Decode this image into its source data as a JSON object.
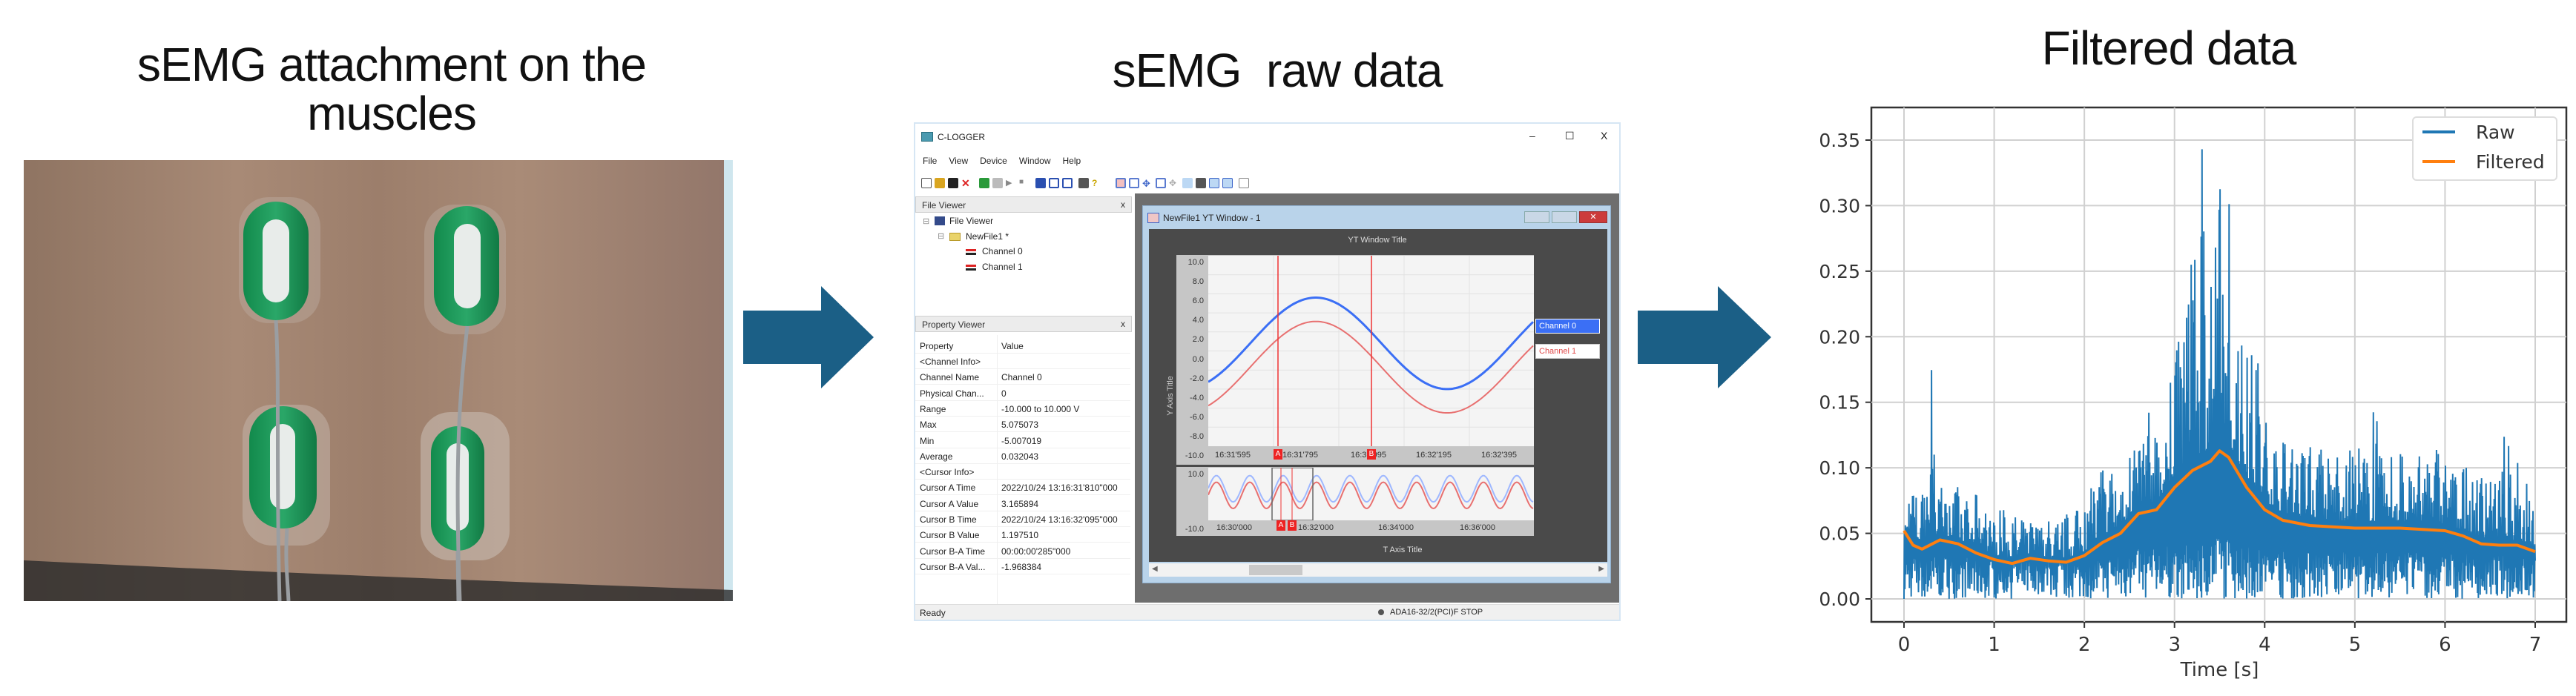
{
  "panels": {
    "left_title_line1": "sEMG attachment on the",
    "left_title_line2": "muscles",
    "middle_title": "sEMG  raw data",
    "right_title": "Filtered data"
  },
  "colors": {
    "arrow": "#1b5f86",
    "sensor": "#1e9a5c",
    "raw": "#1f77b4",
    "filtered": "#ff7f0e",
    "channel0": "#3b6ff5",
    "channel1": "#e14a4a"
  },
  "app": {
    "title": "C-LOGGER",
    "window_controls": [
      "–",
      "☐",
      "X"
    ],
    "menu": [
      "File",
      "View",
      "Device",
      "Window",
      "Help"
    ],
    "file_viewer": {
      "header": "File Viewer",
      "close": "x",
      "tree": {
        "root": "File Viewer",
        "file": "NewFile1 *",
        "channels": [
          "Channel 0",
          "Channel 1"
        ]
      }
    },
    "property_viewer": {
      "header": "Property Viewer",
      "close": "x",
      "columns": [
        "Property",
        "Value"
      ],
      "rows": [
        [
          "<Channel Info>",
          ""
        ],
        [
          "Channel Name",
          "Channel 0"
        ],
        [
          "Physical Chan...",
          "0"
        ],
        [
          "Range",
          "-10.000 to 10.000 V"
        ],
        [
          "Max",
          "5.075073"
        ],
        [
          "Min",
          "-5.007019"
        ],
        [
          "Average",
          "0.032043"
        ],
        [
          "<Cursor Info>",
          ""
        ],
        [
          "Cursor A Time",
          "2022/10/24 13:16:31'810\"000"
        ],
        [
          "Cursor A Value",
          "3.165894"
        ],
        [
          "Cursor B Time",
          "2022/10/24 13:16:32'095\"000"
        ],
        [
          "Cursor B Value",
          "1.197510"
        ],
        [
          "Cursor B-A Time",
          "00:00:00'285\"000"
        ],
        [
          "Cursor B-A Val...",
          "-1.968384"
        ]
      ]
    },
    "yt_window": {
      "title": "NewFile1 YT Window - 1",
      "plot_title": "YT Window Title",
      "y_axis_title": "Y Axis Title",
      "t_axis_title": "T Axis Title",
      "y_ticks": [
        "10.0",
        "8.0",
        "6.0",
        "4.0",
        "2.0",
        "0.0",
        "-2.0",
        "-4.0",
        "-6.0",
        "-8.0",
        "-10.0"
      ],
      "t_ticks": [
        "16:31'595",
        "16:31'795",
        "16:31'995",
        "16:32'195",
        "16:32'395"
      ],
      "overview_y_ticks": [
        "10.0",
        "-10.0"
      ],
      "overview_t_ticks": [
        "16:30'000",
        "16:32'000",
        "16:34'000",
        "16:36'000"
      ],
      "cursor_a": "A",
      "cursor_b": "B",
      "legend": [
        "Channel 0",
        "Channel 1"
      ]
    },
    "status": {
      "left": "Ready",
      "right": "ADA16-32/2(PCI)F STOP"
    }
  },
  "chart_data": {
    "type": "line",
    "title": "Filtered data",
    "xlabel": "Time [s]",
    "ylabel": "",
    "xlim": [
      -0.3,
      7.35
    ],
    "ylim": [
      -0.018,
      0.372
    ],
    "x_ticks": [
      "0",
      "1",
      "2",
      "3",
      "4",
      "5",
      "6",
      "7"
    ],
    "y_ticks": [
      "0.00",
      "0.05",
      "0.10",
      "0.15",
      "0.20",
      "0.25",
      "0.30",
      "0.35"
    ],
    "grid": true,
    "legend": {
      "position": "top-right",
      "entries": [
        "Raw",
        "Filtered"
      ]
    },
    "series": [
      {
        "name": "Raw",
        "note_x_step": 0.1,
        "x_start": 0,
        "envelope_peaks": [
          0.057,
          0.085,
          0.085,
          0.19,
          0.085,
          0.08,
          0.088,
          0.075,
          0.08,
          0.07,
          0.065,
          0.068,
          0.065,
          0.06,
          0.062,
          0.06,
          0.063,
          0.06,
          0.065,
          0.07,
          0.075,
          0.085,
          0.1,
          0.105,
          0.09,
          0.12,
          0.13,
          0.145,
          0.13,
          0.12,
          0.2,
          0.215,
          0.26,
          0.358,
          0.25,
          0.33,
          0.305,
          0.2,
          0.195,
          0.2,
          0.14,
          0.13,
          0.125,
          0.12,
          0.12,
          0.125,
          0.12,
          0.11,
          0.11,
          0.115,
          0.12,
          0.11,
          0.146,
          0.11,
          0.11,
          0.12,
          0.105,
          0.11,
          0.11,
          0.115,
          0.11,
          0.1,
          0.1,
          0.095,
          0.1,
          0.09,
          0.1,
          0.13,
          0.12,
          0.09,
          0.088
        ],
        "min": 0.0
      },
      {
        "name": "Filtered",
        "x": [
          0,
          0.1,
          0.2,
          0.4,
          0.6,
          0.8,
          1.0,
          1.2,
          1.4,
          1.6,
          1.8,
          2.0,
          2.2,
          2.4,
          2.6,
          2.8,
          3.0,
          3.2,
          3.4,
          3.5,
          3.6,
          3.8,
          4.0,
          4.2,
          4.5,
          5.0,
          5.5,
          6.0,
          6.2,
          6.4,
          6.6,
          6.8,
          7.0
        ],
        "y": [
          0.052,
          0.041,
          0.038,
          0.045,
          0.042,
          0.035,
          0.03,
          0.027,
          0.031,
          0.029,
          0.028,
          0.033,
          0.043,
          0.05,
          0.065,
          0.068,
          0.085,
          0.098,
          0.105,
          0.113,
          0.108,
          0.085,
          0.068,
          0.06,
          0.056,
          0.054,
          0.054,
          0.052,
          0.048,
          0.042,
          0.041,
          0.041,
          0.036
        ]
      }
    ]
  }
}
